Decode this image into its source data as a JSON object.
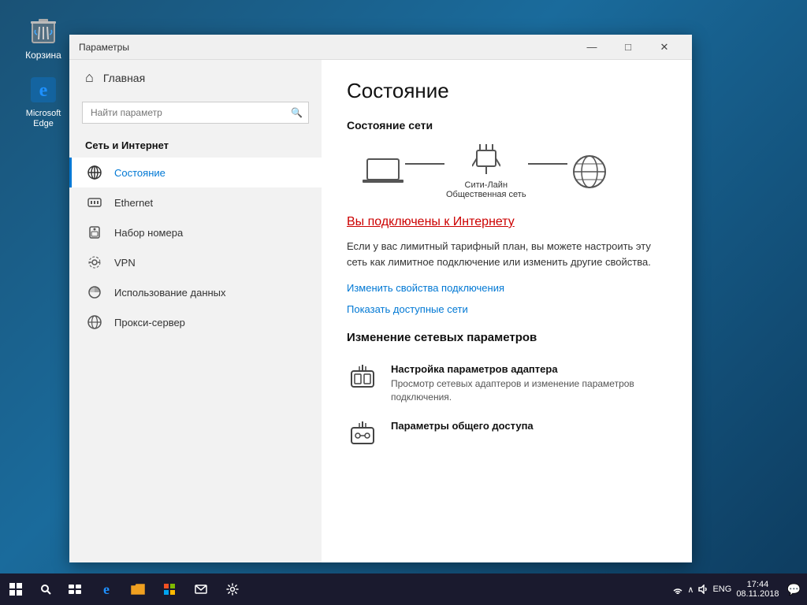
{
  "desktop": {
    "icon_recycle": "Корзина",
    "icon_edge": "Microsoft Edge"
  },
  "taskbar": {
    "start_icon": "⊞",
    "search_icon": "🔍",
    "task_view_icon": "❐",
    "edge_icon": "e",
    "explorer_icon": "📁",
    "store_icon": "🛍",
    "mail_icon": "✉",
    "settings_icon": "⚙",
    "right_icons": "🔍 ∧ 🔊 ENG",
    "time": "17:44",
    "date": "08.11.2018",
    "notification_icon": "💬"
  },
  "window": {
    "title": "Параметры",
    "minimize_btn": "—",
    "maximize_btn": "□",
    "close_btn": "✕"
  },
  "sidebar": {
    "home_label": "Главная",
    "search_placeholder": "Найти параметр",
    "section_title": "Сеть и Интернет",
    "items": [
      {
        "id": "status",
        "label": "Состояние",
        "icon": "🌐",
        "active": true
      },
      {
        "id": "ethernet",
        "label": "Ethernet",
        "icon": "🔌"
      },
      {
        "id": "dialup",
        "label": "Набор номера",
        "icon": "📞"
      },
      {
        "id": "vpn",
        "label": "VPN",
        "icon": "🔒"
      },
      {
        "id": "data-usage",
        "label": "Использование данных",
        "icon": "📊"
      },
      {
        "id": "proxy",
        "label": "Прокси-сервер",
        "icon": "🌐"
      }
    ]
  },
  "main": {
    "title": "Состояние",
    "network_status_title": "Состояние сети",
    "network_name": "Сити-Лайн",
    "network_type": "Общественная сеть",
    "connected_text": "Вы подключены к Интернету",
    "info_text": "Если у вас лимитный тарифный план, вы можете настроить эту сеть как лимитное подключение или изменить другие свойства.",
    "link_change": "Изменить свойства подключения",
    "link_networks": "Показать доступные сети",
    "change_settings_title": "Изменение сетевых параметров",
    "card1_title": "Настройка параметров адаптера",
    "card1_desc": "Просмотр сетевых адаптеров и изменение параметров подключения.",
    "card2_title": "Параметры общего доступа"
  }
}
